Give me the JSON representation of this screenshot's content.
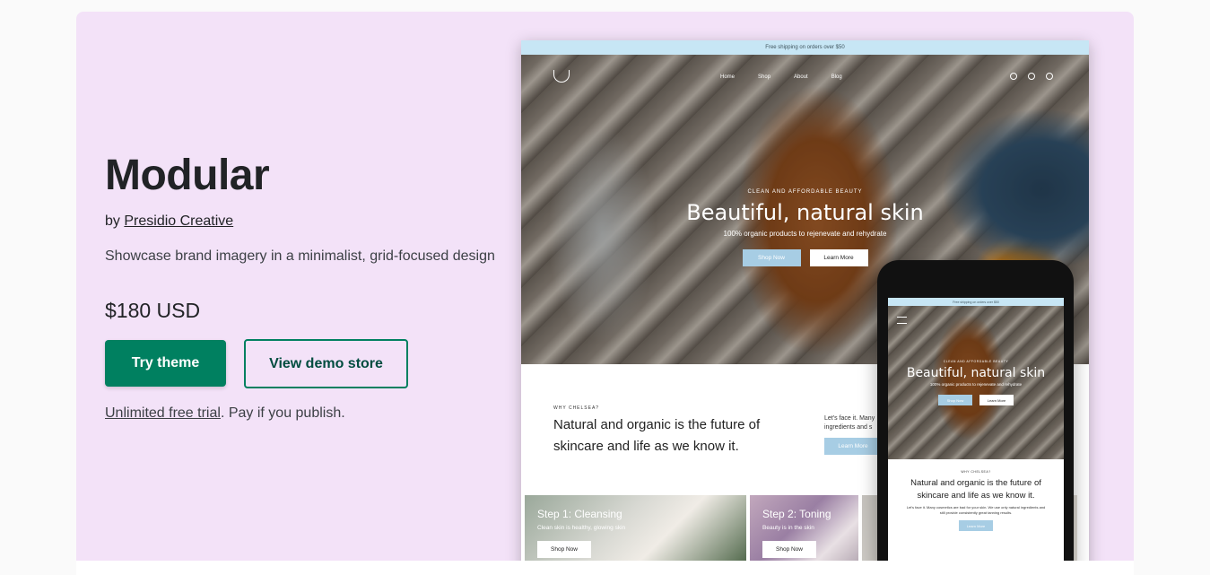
{
  "theme": {
    "title": "Modular",
    "by_prefix": "by",
    "author": "Presidio Creative",
    "description": "Showcase brand imagery in a minimalist, grid-focused design",
    "price": "$180 USD",
    "try_button": "Try theme",
    "demo_button": "View demo store",
    "trial_link": "Unlimited free trial",
    "trial_suffix": ". Pay if you publish."
  },
  "colors": {
    "card_background": "#f3e2f8",
    "primary": "#008060",
    "announcement_bar": "#c7e6f5",
    "accent_button": "#a7cde4"
  },
  "desktop_preview": {
    "announcement": "Free shipping on orders over $50",
    "nav_links": [
      "Home",
      "Shop",
      "About",
      "Blog"
    ],
    "hero_kicker": "CLEAN AND AFFORDABLE BEAUTY",
    "hero_title": "Beautiful, natural skin",
    "hero_subtitle": "100% organic products to rejenevate and rehydrate",
    "hero_button_primary": "Shop Now",
    "hero_button_secondary": "Learn More",
    "why_kicker": "WHY CHELSEA?",
    "why_heading": "Natural and organic is the future of skincare and life as we know it.",
    "why_body": "Let's face it. Many ingredients and s",
    "why_button": "Learn More",
    "steps": [
      {
        "title": "Step 1: Cleansing",
        "subtitle": "Clean skin is healthy, glowing skin",
        "button": "Shop Now"
      },
      {
        "title": "Step 2: Toning",
        "subtitle": "Beauty is in the skin",
        "button": "Shop Now"
      },
      {
        "title": "",
        "subtitle": "",
        "button": ""
      }
    ]
  },
  "mobile_preview": {
    "announcement": "Free shipping on orders over $50",
    "hero_kicker": "CLEAN AND AFFORDABLE BEAUTY",
    "hero_title": "Beautiful, natural skin",
    "hero_subtitle": "100% organic products to rejenevate and rehydrate",
    "hero_button_primary": "Shop Now",
    "hero_button_secondary": "Learn More",
    "why_kicker": "WHY CHELSEA?",
    "why_heading": "Natural and organic is the future of skincare and life as we know it.",
    "why_body": "Let's face it. Many cosmetics are bad for your skin. We use only natural ingredients and still provide consistently great tanning results.",
    "why_button": "Learn More"
  }
}
